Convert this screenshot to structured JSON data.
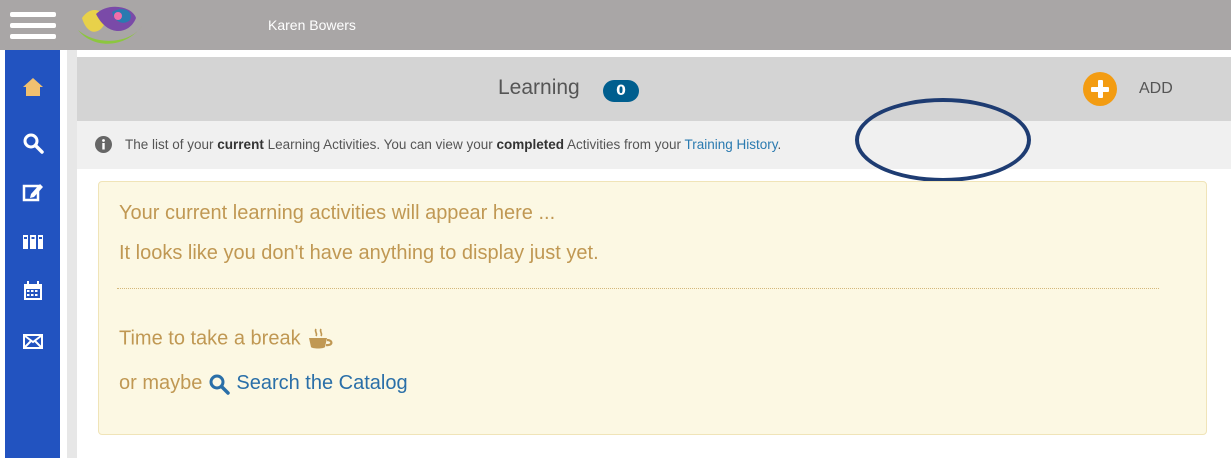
{
  "topbar": {
    "user_name": "Karen Bowers"
  },
  "nav": {
    "icons": [
      "home-icon",
      "search-icon",
      "edit-icon",
      "library-icon",
      "calendar-icon",
      "mail-icon"
    ]
  },
  "header": {
    "title": "Learning",
    "count": "0",
    "add_label": "ADD"
  },
  "info": {
    "part1": "The list of your ",
    "bold1": "current",
    "part2": " Learning Activities. You can view your ",
    "bold2": "completed",
    "part3": " Activities from your ",
    "link": "Training History",
    "part4": "."
  },
  "panel": {
    "line1": "Your current learning activities will appear here ...",
    "line2": "It looks like you don't have anything to display just yet.",
    "break_text": "Time to take a break",
    "or_maybe": "or maybe",
    "search_link": "Search the Catalog"
  },
  "colors": {
    "topbar": "#a9a6a6",
    "leftbar": "#2253c0",
    "accent": "#f39c12",
    "badge": "#005e8e",
    "panel_bg": "#fcf8e3",
    "panel_text": "#c09853",
    "link": "#2a7ab0",
    "annotation": "#1e3c72"
  }
}
